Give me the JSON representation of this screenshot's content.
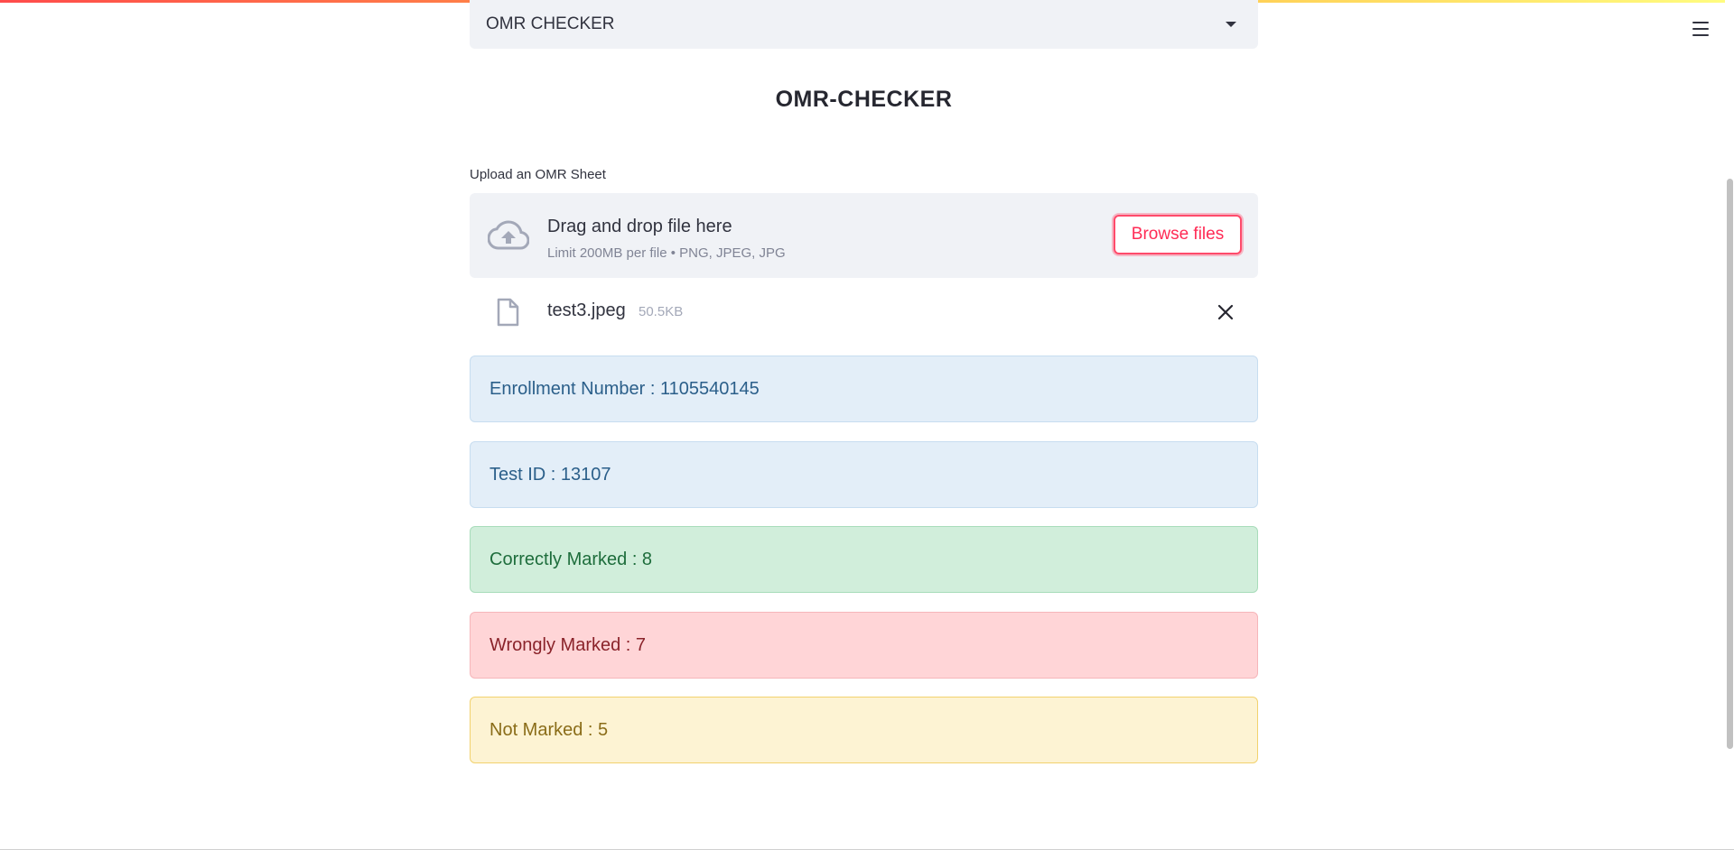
{
  "selector": {
    "value": "OMR CHECKER"
  },
  "page": {
    "title": "OMR-CHECKER"
  },
  "uploader": {
    "label": "Upload an OMR Sheet",
    "drop_title": "Drag and drop file here",
    "limit_text": "Limit 200MB per file • PNG, JPEG, JPG",
    "browse_label": "Browse files",
    "file": {
      "name": "test3.jpeg",
      "size": "50.5KB"
    }
  },
  "results": {
    "enrollment": "Enrollment Number : 1105540145",
    "test_id": "Test ID : 13107",
    "correct": "Correctly Marked : 8",
    "wrong": "Wrongly Marked : 7",
    "not_marked": "Not Marked : 5"
  },
  "icons": {
    "menu": "hamburger-menu-icon",
    "caret": "chevron-down-icon",
    "cloud": "cloud-upload-icon",
    "file": "file-icon",
    "close": "close-icon"
  },
  "colors": {
    "accent": "#ff4b4b",
    "info_bg": "#e3eef8",
    "success_bg": "#d1eedb",
    "error_bg": "#ffd5d7",
    "warning_bg": "#fdf3d3"
  }
}
